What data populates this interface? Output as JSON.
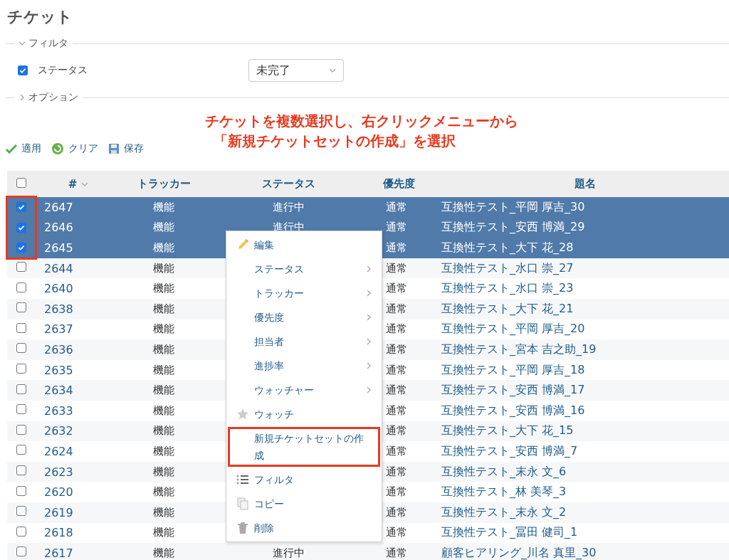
{
  "title": "チケット",
  "filter": {
    "label": "フィルタ",
    "expanded": true,
    "status": {
      "label": "ステータス",
      "checked": true,
      "operator": "未完了"
    }
  },
  "options": {
    "label": "オプション",
    "expanded": false
  },
  "actions": [
    {
      "kind": "apply",
      "label": "適用"
    },
    {
      "kind": "clear",
      "label": "クリア"
    },
    {
      "kind": "save",
      "label": "保存"
    }
  ],
  "annotation": [
    "チケットを複数選択し、右クリックメニューから",
    "「新規チケットセットの作成」を選択"
  ],
  "table": {
    "all_selected": false,
    "columns": [
      "#",
      "トラッカー",
      "ステータス",
      "優先度",
      "題名"
    ],
    "rows": [
      {
        "id": "2647",
        "tracker": "機能",
        "status": "進行中",
        "priority": "通常",
        "subject": "互換性テスト_平岡 厚吉_30",
        "selected": true
      },
      {
        "id": "2646",
        "tracker": "機能",
        "status": "進行中",
        "priority": "通常",
        "subject": "互換性テスト_安西 博満_29",
        "selected": true
      },
      {
        "id": "2645",
        "tracker": "機能",
        "priority": "通常",
        "subject": "互換性テスト_大下 花_28",
        "selected": true
      },
      {
        "id": "2644",
        "tracker": "機能",
        "priority": "通常",
        "subject": "互換性テスト_水口 崇_27",
        "selected": false
      },
      {
        "id": "2640",
        "tracker": "機能",
        "priority": "通常",
        "subject": "互換性テスト_水口 崇_23",
        "selected": false
      },
      {
        "id": "2638",
        "tracker": "機能",
        "priority": "通常",
        "subject": "互換性テスト_大下 花_21",
        "selected": false
      },
      {
        "id": "2637",
        "tracker": "機能",
        "priority": "通常",
        "subject": "互換性テスト_平岡 厚吉_20",
        "selected": false
      },
      {
        "id": "2636",
        "tracker": "機能",
        "priority": "通常",
        "subject": "互換性テスト_宮本 吉之助_19",
        "selected": false
      },
      {
        "id": "2635",
        "tracker": "機能",
        "priority": "通常",
        "subject": "互換性テスト_平岡 厚吉_18",
        "selected": false
      },
      {
        "id": "2634",
        "tracker": "機能",
        "priority": "通常",
        "subject": "互換性テスト_安西 博満_17",
        "selected": false
      },
      {
        "id": "2633",
        "tracker": "機能",
        "priority": "通常",
        "subject": "互換性テスト_安西 博満_16",
        "selected": false
      },
      {
        "id": "2632",
        "tracker": "機能",
        "priority": "通常",
        "subject": "互換性テスト_大下 花_15",
        "selected": false
      },
      {
        "id": "2624",
        "tracker": "機能",
        "priority": "通常",
        "subject": "互換性テスト_安西 博満_7",
        "selected": false
      },
      {
        "id": "2623",
        "tracker": "機能",
        "priority": "通常",
        "subject": "互換性テスト_末永 文_6",
        "selected": false
      },
      {
        "id": "2620",
        "tracker": "機能",
        "priority": "通常",
        "subject": "互換性テスト_林 美琴_3",
        "selected": false
      },
      {
        "id": "2619",
        "tracker": "機能",
        "priority": "通常",
        "subject": "互換性テスト_末永 文_2",
        "selected": false
      },
      {
        "id": "2618",
        "tracker": "機能",
        "priority": "通常",
        "subject": "互換性テスト_冨田 健司_1",
        "selected": false
      },
      {
        "id": "2617",
        "tracker": "機能",
        "status": "進行中",
        "priority": "通常",
        "subject": "顧客ヒアリング_川名 真里_30",
        "selected": false
      }
    ]
  },
  "context_menu": [
    {
      "kind": "edit",
      "label": "編集",
      "submenu": false,
      "highlighted": false
    },
    {
      "kind": "none",
      "label": "ステータス",
      "submenu": true,
      "highlighted": false
    },
    {
      "kind": "none",
      "label": "トラッカー",
      "submenu": true,
      "highlighted": false
    },
    {
      "kind": "none",
      "label": "優先度",
      "submenu": true,
      "highlighted": false
    },
    {
      "kind": "none",
      "label": "担当者",
      "submenu": true,
      "highlighted": false
    },
    {
      "kind": "none",
      "label": "進捗率",
      "submenu": true,
      "highlighted": false
    },
    {
      "kind": "none",
      "label": "ウォッチャー",
      "submenu": true,
      "highlighted": false
    },
    {
      "kind": "watch",
      "label": "ウォッチ",
      "submenu": false,
      "highlighted": false
    },
    {
      "kind": "none",
      "label": "新規チケットセットの作成",
      "submenu": false,
      "highlighted": true
    },
    {
      "kind": "filter",
      "label": "フィルタ",
      "submenu": false,
      "highlighted": false
    },
    {
      "kind": "copy",
      "label": "コピー",
      "submenu": false,
      "highlighted": false
    },
    {
      "kind": "delete",
      "label": "削除",
      "submenu": false,
      "highlighted": false
    }
  ]
}
